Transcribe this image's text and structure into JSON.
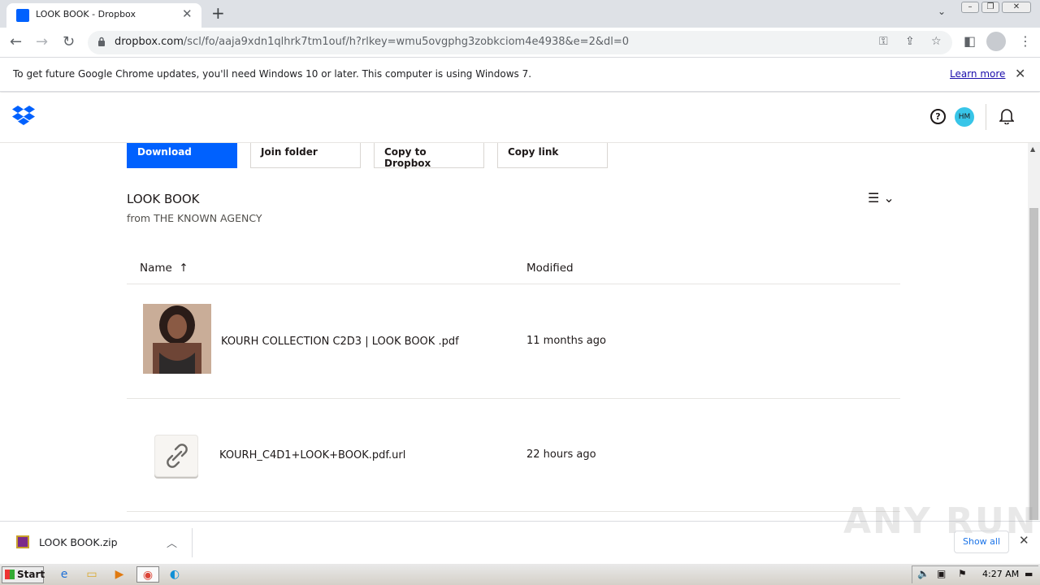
{
  "browser": {
    "tab_title": "LOOK BOOK - Dropbox",
    "url_host": "dropbox.com",
    "url_path": "/scl/fo/aaja9xdn1qlhrk7tm1ouf/h?rlkey=wmu5ovgphg3zobkciom4e4938&e=2&dl=0",
    "info_text": "To get future Google Chrome updates, you'll need Windows 10 or later. This computer is using Windows 7.",
    "learn_more": "Learn more"
  },
  "header": {
    "avatar_initials": "HM",
    "icons": [
      "dropbox-logo-icon",
      "help-icon",
      "bell-icon"
    ]
  },
  "actions": {
    "download": "Download",
    "join_folder": "Join folder",
    "copy_to_dropbox": "Copy to Dropbox",
    "copy_link": "Copy link"
  },
  "folder": {
    "title": "LOOK BOOK",
    "from_label": "from",
    "from_name": "THE KNOWN AGENCY"
  },
  "table": {
    "col_name": "Name",
    "col_modified": "Modified",
    "rows": [
      {
        "name": "KOURH COLLECTION C2D3 | LOOK BOOK .pdf",
        "modified": "11 months ago"
      },
      {
        "name": "KOURH_C4D1+LOOK+BOOK.pdf.url",
        "modified": "22 hours ago"
      }
    ]
  },
  "downloads": {
    "file": "LOOK BOOK.zip",
    "show_all": "Show all"
  },
  "watermark": "ANY RUN",
  "taskbar": {
    "start": "Start",
    "clock": "4:27 AM"
  },
  "colors": {
    "dropbox_blue": "#0061fe",
    "avatar": "#38c5e8"
  }
}
